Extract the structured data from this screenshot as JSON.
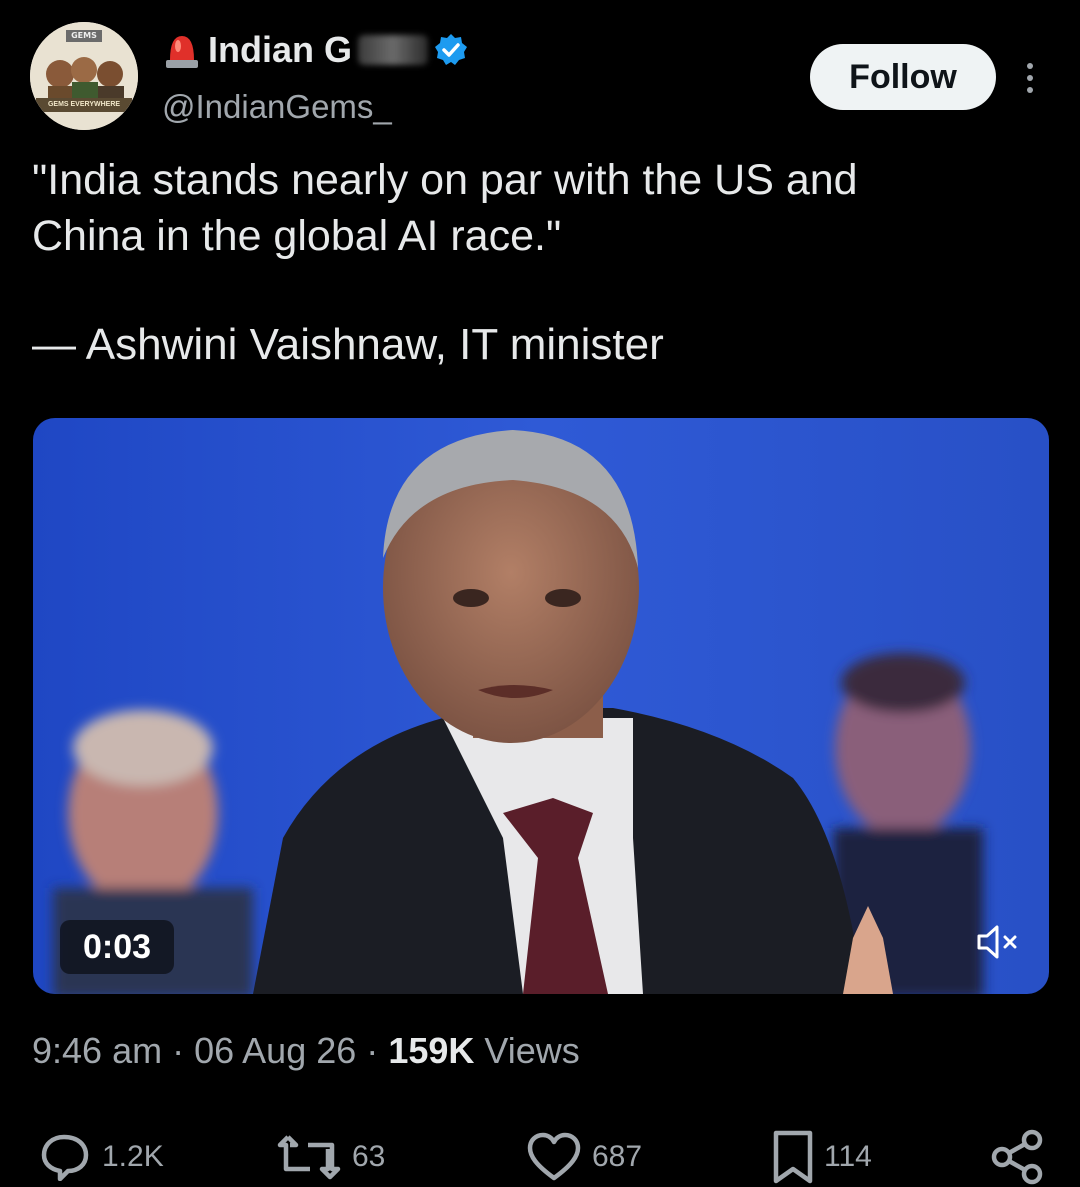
{
  "author": {
    "display_name": "Indian G",
    "handle": "@IndianGems_",
    "avatar_banner_top": "GEMS",
    "avatar_banner_bottom": "GEMS EVERYWHERE"
  },
  "follow_label": "Follow",
  "tweet": {
    "text": "\"India stands nearly on par with the US and\nChina in the global AI race.\"",
    "attribution": "— Ashwini Vaishnaw, IT minister"
  },
  "video": {
    "timecode": "0:03"
  },
  "meta": {
    "time": "9:46 am",
    "separator": "·",
    "date": "06 Aug 26",
    "views_count": "159K",
    "views_label": "Views"
  },
  "actions": {
    "replies": "1.2K",
    "reposts": "63",
    "likes": "687",
    "bookmarks": "114"
  },
  "icons": {
    "more": "more-vertical-icon",
    "verified": "verified-badge-icon",
    "siren": "siren-emoji-icon",
    "mute": "muted-speaker-icon",
    "reply": "reply-icon",
    "repost": "repost-icon",
    "like": "heart-icon",
    "bookmark": "bookmark-icon",
    "share": "share-icon"
  },
  "colors": {
    "background": "#000000",
    "text_primary": "#e7e9ea",
    "text_secondary": "#a1a7ad",
    "verified_blue": "#1d9bf0",
    "follow_bg": "#eff3f4",
    "video_backdrop": "#2f55c8"
  }
}
